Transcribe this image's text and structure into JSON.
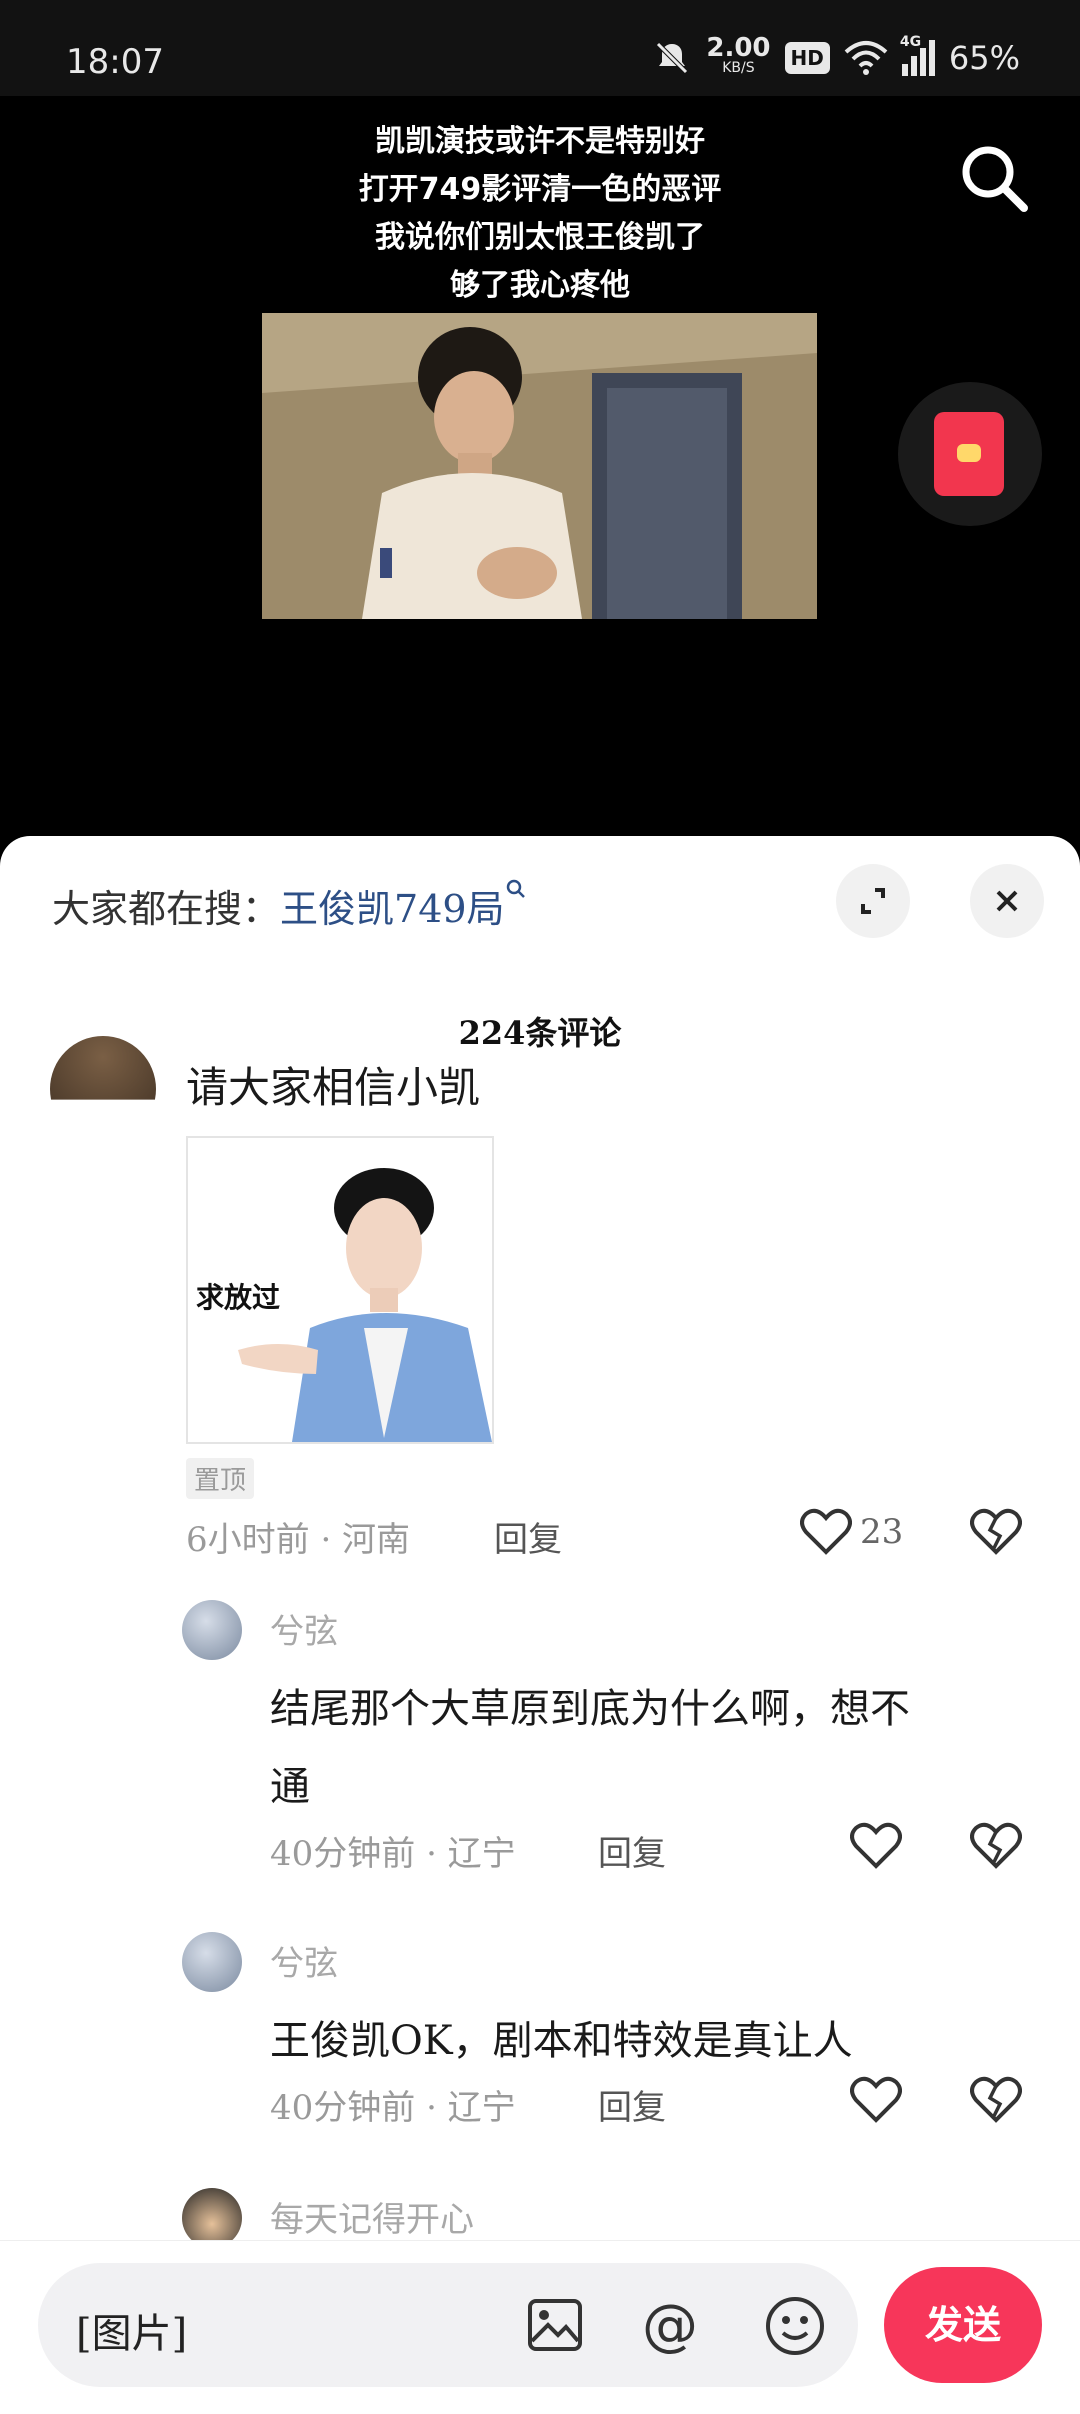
{
  "status_bar": {
    "time": "18:07",
    "net_speed": "2.00",
    "net_unit": "KB/S",
    "hd": "HD",
    "signal": "4G",
    "battery": "65%"
  },
  "video": {
    "caption_lines": [
      "凯凯演技或许不是特别好",
      "打开749影评清一色的恶评",
      "我说你们别太恨王俊凯了",
      "够了我心疼他"
    ]
  },
  "comments_panel": {
    "hot_search_label": "大家都在搜：",
    "hot_search_keyword": "王俊凯749局",
    "comment_count": "224条评论",
    "top_comment": {
      "text": "请大家相信小凯",
      "sticker_text": "求放过",
      "pinned_label": "置顶",
      "meta": "6小时前 · 河南",
      "reply_label": "回复",
      "like_count": "23"
    },
    "replies": [
      {
        "username": "兮弦",
        "text_line1": "结尾那个大草原到底为什么啊，想不",
        "text_line2": "通",
        "meta": "40分钟前 · 辽宁",
        "reply_label": "回复"
      },
      {
        "username": "兮弦",
        "text_line1": "王俊凯OK，剧本和特效是真让人",
        "meta": "40分钟前 · 辽宁",
        "reply_label": "回复"
      },
      {
        "username": "每天记得开心"
      }
    ]
  },
  "input_bar": {
    "placeholder": "[图片]",
    "send_label": "发送"
  },
  "colors": {
    "accent": "#f7365a",
    "keyword": "#2d4f86"
  }
}
